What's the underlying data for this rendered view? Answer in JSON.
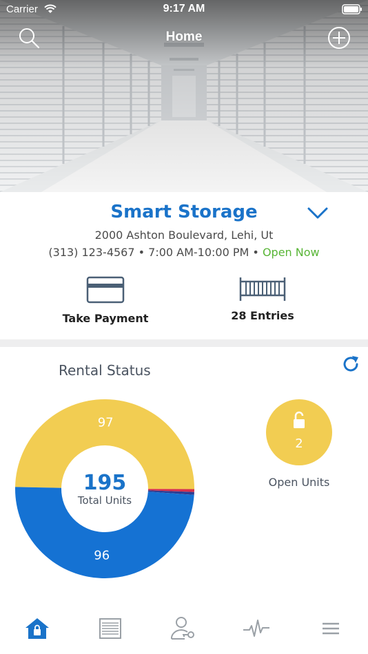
{
  "status_bar": {
    "carrier": "Carrier",
    "time": "9:17 AM"
  },
  "navbar": {
    "title": "Home",
    "left_icon": "search-icon",
    "right_icon": "add-circle-icon"
  },
  "facility": {
    "name": "Smart Storage",
    "address": "2000 Ashton Boulevard, Lehi, Ut",
    "phone": "(313) 123-4567",
    "hours": "7:00 AM-10:00 PM",
    "separator": " • ",
    "open_status": "Open Now",
    "open_color": "#58b536",
    "brand_color": "#1a73c9"
  },
  "actions": [
    {
      "label": "Take Payment",
      "icon": "credit-card-icon"
    },
    {
      "label": "28 Entries",
      "icon": "gate-icon"
    }
  ],
  "rental": {
    "title": "Rental Status",
    "total_value": "195",
    "total_label": "Total Units",
    "open_units": {
      "value": "2",
      "label": "Open Units",
      "icon": "unlocked-padlock-icon"
    }
  },
  "chart_data": {
    "type": "pie",
    "title": "Rental Status",
    "donut": true,
    "total": 195,
    "slices": [
      {
        "value": 97,
        "color": "#f2cd52"
      },
      {
        "value": 96,
        "color": "#1572d3"
      },
      {
        "value": 1,
        "color": "#2d3d93"
      },
      {
        "value": 1,
        "color": "#d6304d"
      }
    ]
  },
  "tabbar": {
    "items": [
      {
        "icon": "home-lock-icon",
        "active": true
      },
      {
        "icon": "storage-unit-icon",
        "active": false
      },
      {
        "icon": "user-key-icon",
        "active": false
      },
      {
        "icon": "activity-pulse-icon",
        "active": false
      },
      {
        "icon": "menu-icon",
        "active": false
      }
    ],
    "active_color": "#1a73c9",
    "inactive_color": "#9aa0a6"
  }
}
